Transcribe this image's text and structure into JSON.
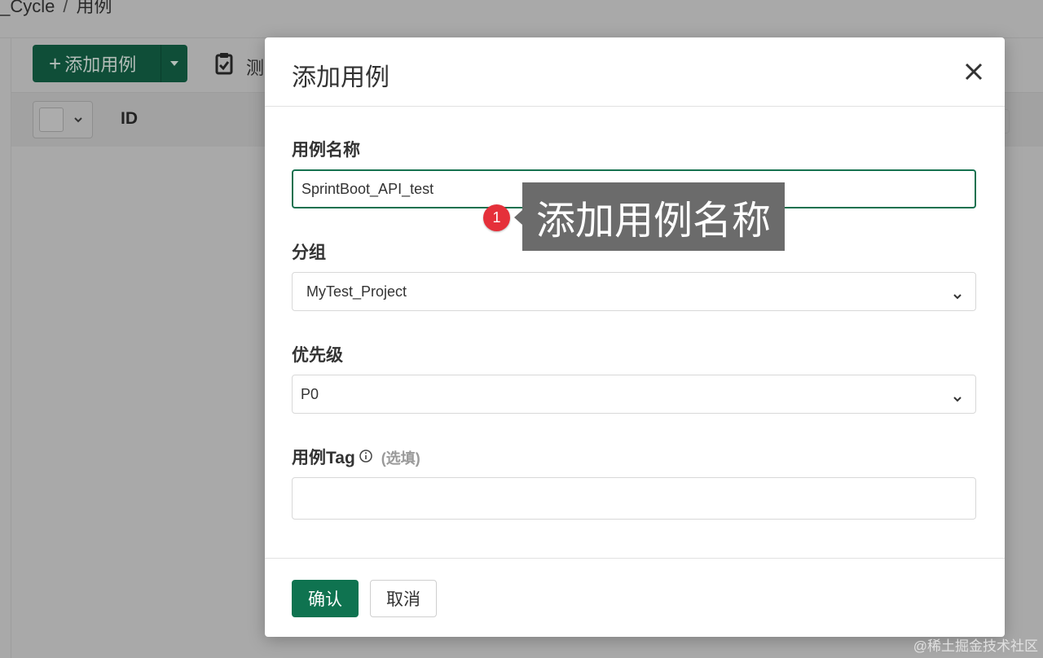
{
  "background": {
    "breadcrumb": [
      "I_Cycle",
      "/",
      "用例"
    ],
    "add_button_label": "添加用例",
    "toolbar_partial_label": "测",
    "column_id": "ID"
  },
  "modal": {
    "title": "添加用例",
    "fields": {
      "name": {
        "label": "用例名称",
        "value": "SprintBoot_API_test"
      },
      "group": {
        "label": "分组",
        "value": "MyTest_Project"
      },
      "priority": {
        "label": "优先级",
        "value": "P0"
      },
      "tag": {
        "label": "用例Tag",
        "optional": "(选填)",
        "value": ""
      }
    },
    "confirm_label": "确认",
    "cancel_label": "取消"
  },
  "annotation": {
    "number": "1",
    "text": "添加用例名称"
  },
  "watermark": "@稀土掘金技术社区",
  "colors": {
    "primary": "#0f7350",
    "annotation_badge": "#e5303a",
    "annotation_box": "#6b6b6b"
  }
}
